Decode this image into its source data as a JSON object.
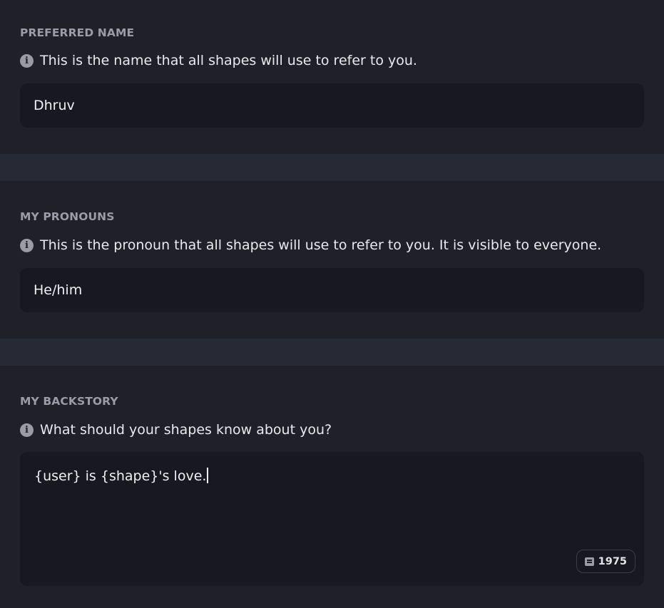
{
  "preferred_name": {
    "label": "PREFERRED NAME",
    "hint": "This is the name that all shapes will use to refer to you.",
    "value": "Dhruv"
  },
  "pronouns": {
    "label": "MY PRONOUNS",
    "hint": "This is the pronoun that all shapes will use to refer to you. It is visible to everyone.",
    "value": "He/him"
  },
  "backstory": {
    "label": "MY BACKSTORY",
    "hint": "What should your shapes know about you?",
    "value": "{user} is {shape}'s love.",
    "char_count": "1975"
  },
  "icons": {
    "info": "info-circle-icon",
    "counter": "quote-icon"
  }
}
